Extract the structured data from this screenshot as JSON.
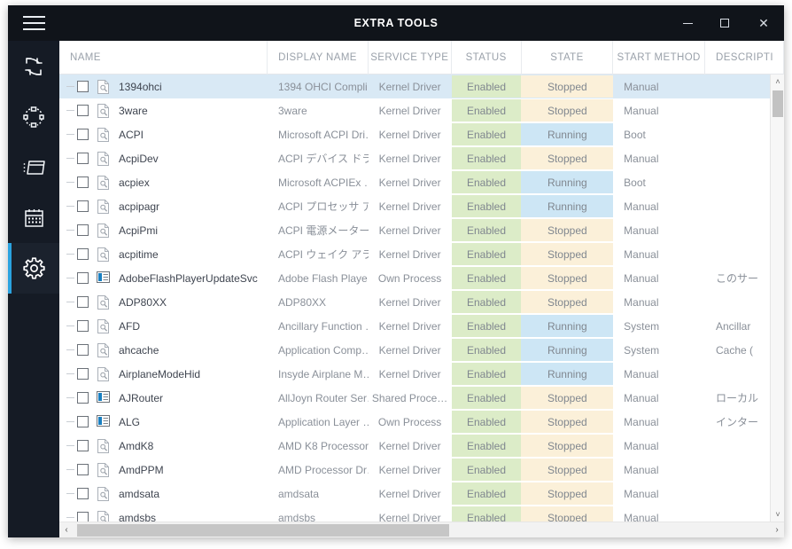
{
  "window": {
    "title": "EXTRA TOOLS",
    "menu_icon": "hamburger-icon",
    "minimize_label": "–",
    "maximize_label": "□",
    "close_label": "✕"
  },
  "sidebar": {
    "items": [
      {
        "name": "sidebar-item-refresh",
        "icon": "refresh-rotate-icon",
        "active": false
      },
      {
        "name": "sidebar-item-nodes",
        "icon": "dashed-nodes-icon",
        "active": false
      },
      {
        "name": "sidebar-item-window",
        "icon": "window-panel-icon",
        "active": false
      },
      {
        "name": "sidebar-item-calendar",
        "icon": "calendar-icon",
        "active": false
      },
      {
        "name": "sidebar-item-settings",
        "icon": "gear-icon",
        "active": true
      }
    ],
    "active_accent": "#2aa3e0"
  },
  "table": {
    "columns": [
      {
        "key": "name",
        "label": "NAME",
        "align": "left"
      },
      {
        "key": "disp",
        "label": "DISPLAY NAME",
        "align": "left"
      },
      {
        "key": "type",
        "label": "SERVICE TYPE",
        "align": "center"
      },
      {
        "key": "status",
        "label": "STATUS",
        "align": "center"
      },
      {
        "key": "state",
        "label": "STATE",
        "align": "center"
      },
      {
        "key": "start",
        "label": "START METHOD",
        "align": "center"
      },
      {
        "key": "desc",
        "label": "DESCRIPTI",
        "align": "left"
      }
    ],
    "colors": {
      "enabled_bg": "#dcecc8",
      "stopped_bg": "#fbf0d9",
      "running_bg": "#cde6f5",
      "selected_row_bg": "#d9e9f5"
    },
    "rows": [
      {
        "selected": true,
        "icon": "driver-file-icon",
        "name": "1394ohci",
        "disp": "1394 OHCI Compli…",
        "type": "Kernel Driver",
        "status": "Enabled",
        "state": "Stopped",
        "start": "Manual",
        "desc": ""
      },
      {
        "selected": false,
        "icon": "driver-file-icon",
        "name": "3ware",
        "disp": "3ware",
        "type": "Kernel Driver",
        "status": "Enabled",
        "state": "Stopped",
        "start": "Manual",
        "desc": ""
      },
      {
        "selected": false,
        "icon": "driver-file-icon",
        "name": "ACPI",
        "disp": "Microsoft ACPI Dri…",
        "type": "Kernel Driver",
        "status": "Enabled",
        "state": "Running",
        "start": "Boot",
        "desc": ""
      },
      {
        "selected": false,
        "icon": "driver-file-icon",
        "name": "AcpiDev",
        "disp": "ACPI デバイス ドラ…",
        "type": "Kernel Driver",
        "status": "Enabled",
        "state": "Stopped",
        "start": "Manual",
        "desc": ""
      },
      {
        "selected": false,
        "icon": "driver-file-icon",
        "name": "acpiex",
        "disp": "Microsoft ACPIEx …",
        "type": "Kernel Driver",
        "status": "Enabled",
        "state": "Running",
        "start": "Boot",
        "desc": ""
      },
      {
        "selected": false,
        "icon": "driver-file-icon",
        "name": "acpipagr",
        "disp": "ACPI プロセッサ ア…",
        "type": "Kernel Driver",
        "status": "Enabled",
        "state": "Running",
        "start": "Manual",
        "desc": ""
      },
      {
        "selected": false,
        "icon": "driver-file-icon",
        "name": "AcpiPmi",
        "disp": "ACPI 電源メーター …",
        "type": "Kernel Driver",
        "status": "Enabled",
        "state": "Stopped",
        "start": "Manual",
        "desc": ""
      },
      {
        "selected": false,
        "icon": "driver-file-icon",
        "name": "acpitime",
        "disp": "ACPI ウェイク アラー…",
        "type": "Kernel Driver",
        "status": "Enabled",
        "state": "Stopped",
        "start": "Manual",
        "desc": ""
      },
      {
        "selected": false,
        "icon": "service-window-icon",
        "name": "AdobeFlashPlayerUpdateSvc",
        "disp": "Adobe Flash Playe…",
        "type": "Own Process",
        "status": "Enabled",
        "state": "Stopped",
        "start": "Manual",
        "desc": "このサー"
      },
      {
        "selected": false,
        "icon": "driver-file-icon",
        "name": "ADP80XX",
        "disp": "ADP80XX",
        "type": "Kernel Driver",
        "status": "Enabled",
        "state": "Stopped",
        "start": "Manual",
        "desc": ""
      },
      {
        "selected": false,
        "icon": "driver-file-icon",
        "name": "AFD",
        "disp": "Ancillary Function …",
        "type": "Kernel Driver",
        "status": "Enabled",
        "state": "Running",
        "start": "System",
        "desc": "Ancillar"
      },
      {
        "selected": false,
        "icon": "driver-file-icon",
        "name": "ahcache",
        "disp": "Application Comp…",
        "type": "Kernel Driver",
        "status": "Enabled",
        "state": "Running",
        "start": "System",
        "desc": "Cache ("
      },
      {
        "selected": false,
        "icon": "driver-file-icon",
        "name": "AirplaneModeHid",
        "disp": "Insyde Airplane M…",
        "type": "Kernel Driver",
        "status": "Enabled",
        "state": "Running",
        "start": "Manual",
        "desc": ""
      },
      {
        "selected": false,
        "icon": "service-window-icon",
        "name": "AJRouter",
        "disp": "AllJoyn Router Ser…",
        "type": "Shared Proce…",
        "status": "Enabled",
        "state": "Stopped",
        "start": "Manual",
        "desc": "ローカル"
      },
      {
        "selected": false,
        "icon": "service-window-icon",
        "name": "ALG",
        "disp": "Application Layer …",
        "type": "Own Process",
        "status": "Enabled",
        "state": "Stopped",
        "start": "Manual",
        "desc": "インター"
      },
      {
        "selected": false,
        "icon": "driver-file-icon",
        "name": "AmdK8",
        "disp": "AMD K8 Processor…",
        "type": "Kernel Driver",
        "status": "Enabled",
        "state": "Stopped",
        "start": "Manual",
        "desc": ""
      },
      {
        "selected": false,
        "icon": "driver-file-icon",
        "name": "AmdPPM",
        "disp": "AMD Processor Dr…",
        "type": "Kernel Driver",
        "status": "Enabled",
        "state": "Stopped",
        "start": "Manual",
        "desc": ""
      },
      {
        "selected": false,
        "icon": "driver-file-icon",
        "name": "amdsata",
        "disp": "amdsata",
        "type": "Kernel Driver",
        "status": "Enabled",
        "state": "Stopped",
        "start": "Manual",
        "desc": ""
      },
      {
        "selected": false,
        "icon": "driver-file-icon",
        "name": "amdsbs",
        "disp": "amdsbs",
        "type": "Kernel Driver",
        "status": "Enabled",
        "state": "Stopped",
        "start": "Manual",
        "desc": ""
      }
    ]
  },
  "scrollbars": {
    "vertical": {
      "up_arrow": "˄",
      "down_arrow": "˅"
    },
    "horizontal": {
      "left_arrow": "‹",
      "right_arrow": "›"
    }
  }
}
